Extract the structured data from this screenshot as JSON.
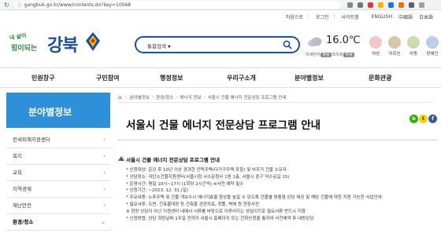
{
  "browser": {
    "url": "gangbuk.go.kr/www/contents.do?key=10068",
    "lock_glyph": "ⓘ"
  },
  "util_nav": {
    "items": [
      "처음으로",
      "로그인",
      "사이트맵",
      "ENGLISH",
      "中國語",
      "日本語"
    ]
  },
  "logo": {
    "slogan_line1": "내 삶이",
    "slogan_line2": "힘이되는",
    "name": "강북"
  },
  "search": {
    "select_label": "통합검색"
  },
  "weather": {
    "temperature": "16.0℃",
    "dust_label": "미세먼지",
    "dust_status": "좋음",
    "ultrafine_label": "초미세",
    "ultrafine_status": "좋음"
  },
  "personas": [
    "여성",
    "어르신",
    "아동",
    "장애인"
  ],
  "main_nav": [
    "민원창구",
    "구민참여",
    "행정정보",
    "우리구소개",
    "분야별정보",
    "문화관광"
  ],
  "sidebar": {
    "title": "분야별정보",
    "items": [
      {
        "label": "전세피해지원센터"
      },
      {
        "label": "복지"
      },
      {
        "label": "교육"
      },
      {
        "label": "지역경제"
      },
      {
        "label": "재난안전"
      },
      {
        "label": "환경/청소"
      }
    ]
  },
  "breadcrumb": [
    "분야별정보",
    "환경/청소",
    "에너지 정보",
    "서울시 건물 에너지 전문상담 프로그램 안내"
  ],
  "content": {
    "title": "서울시 건물 에너지 전문상담 프로그램 안내",
    "section_heading": "서울시 건물 에너지 전문상담 프로그램 안내",
    "details": [
      "* 신청대상: 준공 후 10년 이상 경과한 단독주택(다가구주택 포함) 및 비주거 건물 소유자",
      "* 상담장소: 저탄소건물지원센터(서울시청 서소문청사 1동 1층, 서울시 중구 덕수궁길 15)",
      "* 운영시간: 평일 10시~17시 (1회당 2시간씩) ※사전 예약 필수",
      "* 신청기간: ~2023. 12. 31.(일)",
      "* 주요내용: 노후주택 및 건물 개보수시 에너지효율 향상을 높일 수 있도록 건물별 맞춤형 상담 제공 및 해당 건물에 대한 지원 가능한 사업안내",
      "* 필요서류: 도면, 건축물대장 등 건축물 관련자료, 창틀, 벽체 등 현장사진",
      "  ※ 현장 상담이 아닌 지원센터 내에서 서류를 바탕으로 이루어지는 상담이므로 필요서류 반드시 지참",
      "* 신청방법: 상담 희망날짜 1주일 전까지 서울시 홈페이지 또는 전화신청을 통하여 사전예약 후 내방상담"
    ]
  },
  "colors": {
    "brand_blue": "#1b4fa0",
    "sidebar_blue": "#2f8fd8",
    "slogan_green": "#2a8a3a"
  },
  "share_icons": [
    "blog-icon",
    "kakao-icon",
    "facebook-icon"
  ]
}
